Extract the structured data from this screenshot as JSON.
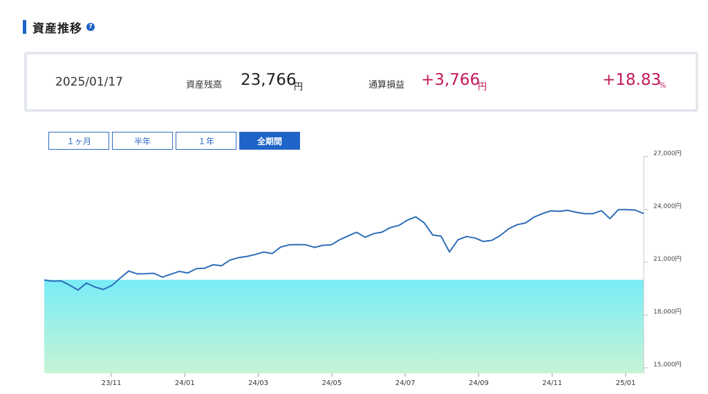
{
  "section": {
    "title": "資産推移",
    "help": "?"
  },
  "summary": {
    "date": "2025/01/17",
    "balance_label": "資産残高",
    "balance_value": "23,766",
    "balance_unit": "円",
    "pl_label": "通算損益",
    "pl_value": "+3,766",
    "pl_unit": "円",
    "pl_pct": "+18.83",
    "pl_pct_unit": "%"
  },
  "range_buttons": [
    {
      "label": "１ヶ月",
      "active": false
    },
    {
      "label": "半年",
      "active": false
    },
    {
      "label": "１年",
      "active": false
    },
    {
      "label": "全期間",
      "active": true
    }
  ],
  "colors": {
    "line": "#2b6cb8",
    "fill_top": "#78ecf7",
    "fill_bottom": "#c6f4d4",
    "accent": "#1e63c8",
    "positive": "#c2185b"
  },
  "chart_data": {
    "type": "area",
    "title": "",
    "xlabel": "",
    "ylabel": "",
    "ylim": [
      15000,
      27000
    ],
    "baseline": 20000,
    "y_ticks": [
      {
        "value": 27000,
        "label": "27,000円"
      },
      {
        "value": 24000,
        "label": "24,000円"
      },
      {
        "value": 21000,
        "label": "21,000円"
      },
      {
        "value": 18000,
        "label": "18,000円"
      },
      {
        "value": 15000,
        "label": "15,000円"
      }
    ],
    "x_ticks": [
      "23/11",
      "24/01",
      "24/03",
      "24/05",
      "24/07",
      "24/09",
      "24/11",
      "25/01"
    ],
    "series": [
      {
        "points": [
          [
            0.0,
            19990
          ],
          [
            0.5,
            19920
          ],
          [
            1.0,
            19940
          ],
          [
            1.5,
            19700
          ],
          [
            2.0,
            19420
          ],
          [
            2.5,
            19810
          ],
          [
            3.0,
            19590
          ],
          [
            3.5,
            19450
          ],
          [
            4.0,
            19680
          ],
          [
            4.5,
            20100
          ],
          [
            5.0,
            20500
          ],
          [
            5.5,
            20340
          ],
          [
            6.0,
            20350
          ],
          [
            6.5,
            20370
          ],
          [
            7.0,
            20150
          ],
          [
            7.5,
            20320
          ],
          [
            8.0,
            20480
          ],
          [
            8.5,
            20390
          ],
          [
            9.0,
            20630
          ],
          [
            9.5,
            20660
          ],
          [
            10.0,
            20860
          ],
          [
            10.5,
            20800
          ],
          [
            11.0,
            21120
          ],
          [
            11.5,
            21260
          ],
          [
            12.0,
            21330
          ],
          [
            12.5,
            21440
          ],
          [
            13.0,
            21580
          ],
          [
            13.5,
            21490
          ],
          [
            14.0,
            21860
          ],
          [
            14.5,
            21990
          ],
          [
            15.0,
            22000
          ],
          [
            15.5,
            21990
          ],
          [
            16.0,
            21840
          ],
          [
            16.5,
            21960
          ],
          [
            17.0,
            21990
          ],
          [
            17.5,
            22280
          ],
          [
            18.0,
            22500
          ],
          [
            18.5,
            22700
          ],
          [
            19.0,
            22420
          ],
          [
            19.5,
            22620
          ],
          [
            20.0,
            22710
          ],
          [
            20.5,
            22970
          ],
          [
            21.0,
            23090
          ],
          [
            21.5,
            23390
          ],
          [
            22.0,
            23580
          ],
          [
            22.5,
            23240
          ],
          [
            23.0,
            22550
          ],
          [
            23.5,
            22480
          ],
          [
            24.0,
            21580
          ],
          [
            24.5,
            22280
          ],
          [
            25.0,
            22460
          ],
          [
            25.5,
            22380
          ],
          [
            26.0,
            22180
          ],
          [
            26.5,
            22240
          ],
          [
            27.0,
            22510
          ],
          [
            27.5,
            22900
          ],
          [
            28.0,
            23130
          ],
          [
            28.5,
            23230
          ],
          [
            29.0,
            23560
          ],
          [
            29.5,
            23760
          ],
          [
            30.0,
            23920
          ],
          [
            30.5,
            23890
          ],
          [
            31.0,
            23950
          ],
          [
            31.5,
            23840
          ],
          [
            32.0,
            23760
          ],
          [
            32.5,
            23760
          ],
          [
            33.0,
            23930
          ],
          [
            33.5,
            23480
          ],
          [
            34.0,
            23990
          ],
          [
            34.5,
            23990
          ],
          [
            35.0,
            23960
          ],
          [
            35.5,
            23766
          ]
        ]
      }
    ]
  }
}
